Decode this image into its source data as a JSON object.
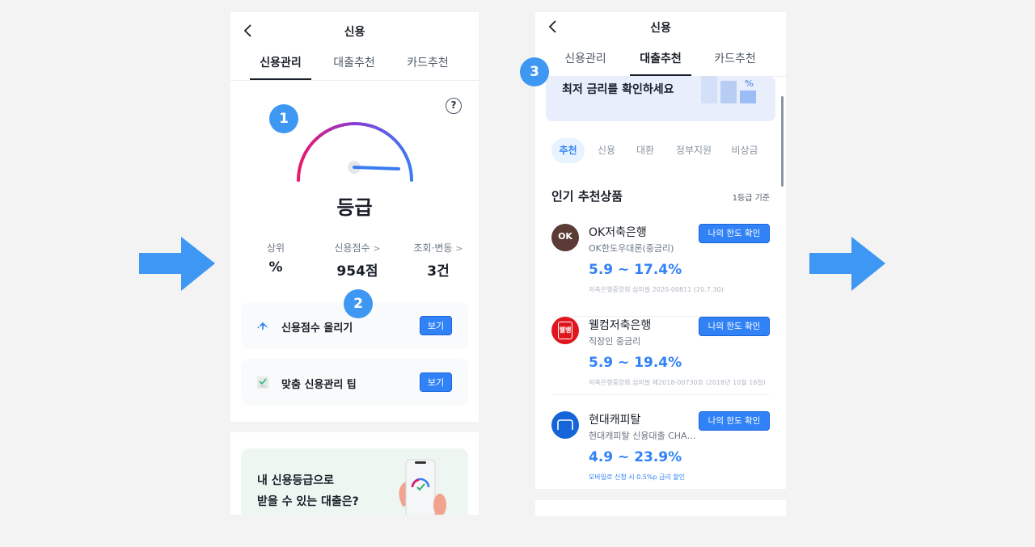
{
  "left": {
    "title": "신용",
    "tabs": [
      "신용관리",
      "대출추천",
      "카드추천"
    ],
    "badges": [
      "1",
      "2"
    ],
    "help": "?",
    "grade": "등급",
    "stats": [
      {
        "label": "상위",
        "value": "%"
      },
      {
        "label": "신용점수",
        "value": "954점"
      },
      {
        "label": "조회·변동",
        "value": "3건"
      }
    ],
    "cards": [
      {
        "label": "신용점수 올리기",
        "button": "보기",
        "icon": "arrow-up-circle-icon"
      },
      {
        "label": "맞춤 신용관리 팁",
        "button": "보기",
        "icon": "checklist-icon"
      }
    ],
    "promo": {
      "line1": "내 신용등급으로",
      "line2": "받을 수 있는 대출은?"
    }
  },
  "right": {
    "title": "신용",
    "tabs": [
      "신용관리",
      "대출추천",
      "카드추천"
    ],
    "badge": "3",
    "banner": "최저 금리를 확인하세요",
    "banner_symbol": "%",
    "chips": [
      "추천",
      "신용",
      "대환",
      "정부지원",
      "비상금"
    ],
    "section_title": "인기 추천상품",
    "section_note": "1등급 기준",
    "products": [
      {
        "name": "OK저축은행",
        "sub": "OK한도우대론(중금리)",
        "rate": "5.9 ~ 17.4%",
        "fine": "저축은행중앙회 심의필 2020-00811 (20.7.30)",
        "button": "나의 한도 확인",
        "logo_text": "OK",
        "logo_color": "#5a3b35"
      },
      {
        "name": "웰컴저축은행",
        "sub": "직장인 중금리",
        "rate": "5.9 ~ 19.4%",
        "fine": "저축은행중앙회 심의필 제2018-00730호 (2018년 10월 16일)",
        "button": "나의 한도 확인",
        "logo_text": "웰뱅",
        "logo_color": "#e0161e"
      },
      {
        "name": "현대캐피탈",
        "sub": "현대캐피탈 신용대출 CHANCE",
        "rate": "4.9 ~ 23.9%",
        "fine": "모바일로 신청 시 0.5%p 금리 할인",
        "button": "나의 한도 확인",
        "logo_text": "",
        "logo_color": "#1565d8"
      }
    ]
  },
  "colors": {
    "accent": "#3182f6",
    "badge": "#3d97f3",
    "gauge_start": "#e8196a",
    "gauge_end": "#3b7cf0"
  }
}
